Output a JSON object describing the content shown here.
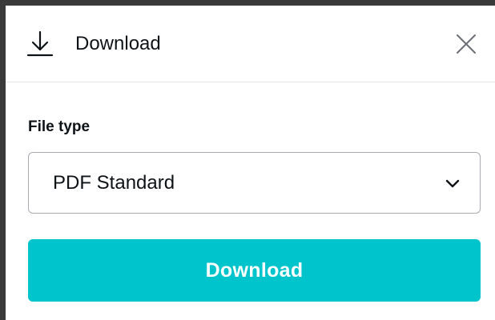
{
  "header": {
    "title": "Download",
    "icon": "download-icon",
    "close_icon": "close-icon"
  },
  "file_type": {
    "label": "File type",
    "selected": "PDF Standard",
    "chevron_icon": "chevron-down-icon"
  },
  "action": {
    "download_label": "Download"
  },
  "colors": {
    "accent": "#00c4cc",
    "text": "#0e1318",
    "border": "#a8abb0",
    "divider": "#e2e4e7"
  }
}
